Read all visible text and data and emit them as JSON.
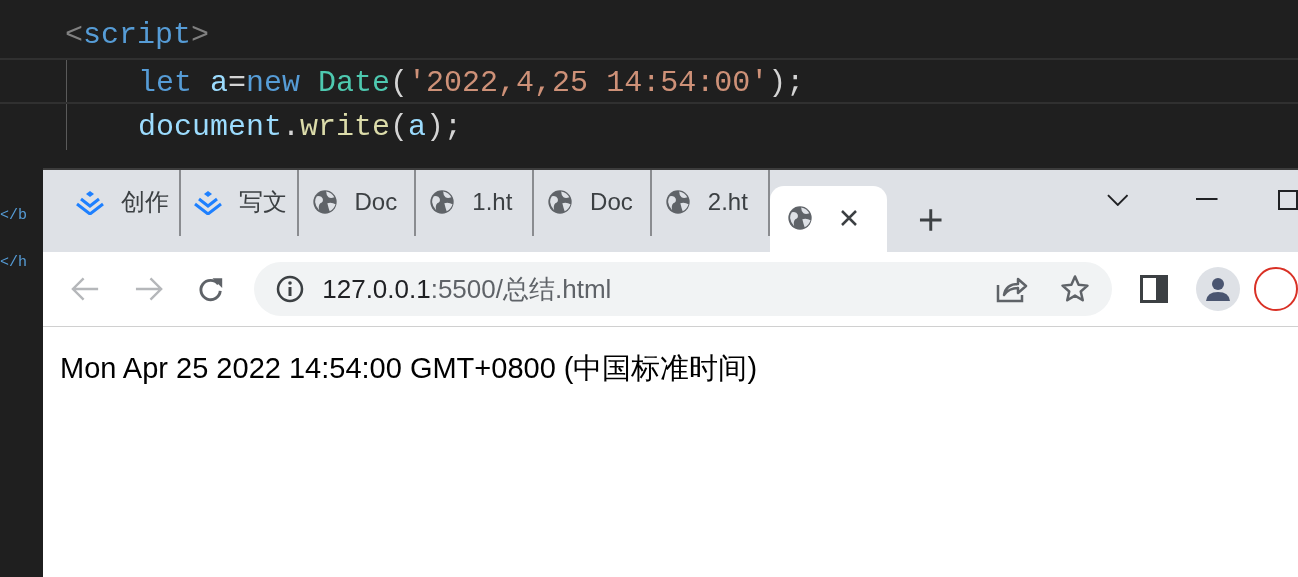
{
  "editor": {
    "lines": [
      {
        "current": false,
        "tokens": [
          {
            "kind": "punct",
            "text": "<"
          },
          {
            "kind": "tag",
            "text": "script"
          },
          {
            "kind": "punct",
            "text": ">"
          }
        ],
        "children": [
          {
            "current": true,
            "tokens": [
              {
                "kind": "keyword",
                "text": "let "
              },
              {
                "kind": "var",
                "text": "a"
              },
              {
                "kind": "plain",
                "text": "="
              },
              {
                "kind": "keyword",
                "text": "new "
              },
              {
                "kind": "class",
                "text": "Date"
              },
              {
                "kind": "plain",
                "text": "("
              },
              {
                "kind": "string",
                "text": "'2022,4,25 14:54:00'"
              },
              {
                "kind": "plain",
                "text": ");"
              }
            ]
          },
          {
            "current": false,
            "tokens": [
              {
                "kind": "var",
                "text": "document"
              },
              {
                "kind": "plain",
                "text": "."
              },
              {
                "kind": "func",
                "text": "write"
              },
              {
                "kind": "plain",
                "text": "("
              },
              {
                "kind": "var",
                "text": "a"
              },
              {
                "kind": "plain",
                "text": ");"
              }
            ]
          }
        ]
      }
    ],
    "side_fragments": [
      "</b",
      "</h"
    ]
  },
  "browser": {
    "tabs": [
      {
        "kind": "app",
        "label": "创作",
        "selected": false
      },
      {
        "kind": "app",
        "label": "写文",
        "selected": false
      },
      {
        "kind": "globe",
        "label": "Doc",
        "selected": false
      },
      {
        "kind": "globe",
        "label": "1.ht",
        "selected": false
      },
      {
        "kind": "globe",
        "label": "Doc",
        "selected": false
      },
      {
        "kind": "globe",
        "label": "2.ht",
        "selected": false
      },
      {
        "kind": "globe",
        "selected": true
      }
    ],
    "address": {
      "host": "127.0.0.1",
      "path": ":5500/总结.html"
    },
    "page_text": "Mon Apr 25 2022 14:54:00 GMT+0800 (中国标准时间)"
  }
}
